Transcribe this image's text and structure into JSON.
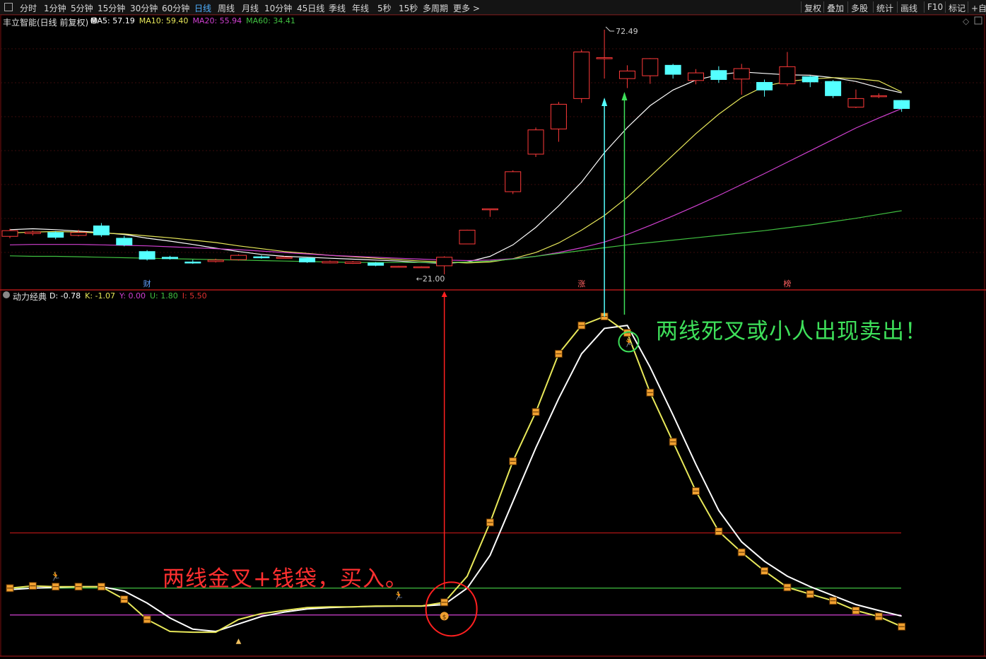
{
  "toolbar": {
    "period_tabs": [
      "分时",
      "1分钟",
      "5分钟",
      "15分钟",
      "30分钟",
      "60分钟",
      "日线",
      "周线",
      "月线",
      "10分钟",
      "45日线",
      "季线",
      "年线",
      "5秒",
      "15秒",
      "多周期",
      "更多 >"
    ],
    "active_tab": "日线",
    "right_tools": [
      "复权",
      "叠加",
      "多股",
      "统计",
      "画线",
      "F10",
      "标记",
      "+自"
    ]
  },
  "main_panel": {
    "stock_title": "丰立智能(日线 前复权)",
    "ma_legend": [
      {
        "label": "MA5: 57.19",
        "color": "#ffffff"
      },
      {
        "label": "MA10: 59.40",
        "color": "#e8e85a"
      },
      {
        "label": "MA20: 55.94",
        "color": "#d040d0"
      },
      {
        "label": "MA60: 34.41",
        "color": "#40c040"
      }
    ],
    "high_label": "72.49",
    "low_label": "21.00",
    "event_tags": [
      "财",
      "涨",
      "榜"
    ]
  },
  "sub_panel": {
    "indicator_name": "动力经典",
    "legend": [
      {
        "label": "D: -0.78",
        "color": "#ffffff"
      },
      {
        "label": "K: -1.07",
        "color": "#e8e85a"
      },
      {
        "label": "Y: 0.00",
        "color": "#d040d0"
      },
      {
        "label": "U: 1.80",
        "color": "#40c040"
      },
      {
        "label": "I: 5.50",
        "color": "#e03030"
      }
    ]
  },
  "annotations": {
    "buy_text": "两线金叉+钱袋，买入。",
    "sell_text": "两线死叉或小人出现卖出！"
  },
  "colors": {
    "up_candle": "#ff3a3a",
    "down_candle": "#54ffff",
    "ma5": "#ffffff",
    "ma10": "#e8e85a",
    "ma20": "#d040d0",
    "ma60": "#40c040",
    "k_line": "#e8e85a",
    "d_line": "#ffffff",
    "buy_text": "#ff3030",
    "sell_text": "#3ee05a",
    "marker": "#f0a030"
  },
  "chart_data": [
    {
      "type": "candlestick",
      "title": "丰立智能(日线 前复权)",
      "ylim": [
        21.0,
        72.49
      ],
      "candles": [
        {
          "o": 29.0,
          "c": 30.2,
          "h": 30.6,
          "l": 28.6
        },
        {
          "o": 29.6,
          "c": 29.9,
          "h": 30.2,
          "l": 29.2
        },
        {
          "o": 29.8,
          "c": 28.8,
          "h": 30.1,
          "l": 28.4
        },
        {
          "o": 29.2,
          "c": 29.8,
          "h": 30.4,
          "l": 29.0
        },
        {
          "o": 31.2,
          "c": 29.3,
          "h": 31.8,
          "l": 28.9
        },
        {
          "o": 28.6,
          "c": 27.2,
          "h": 29.1,
          "l": 26.9
        },
        {
          "o": 25.8,
          "c": 24.2,
          "h": 26.1,
          "l": 23.9
        },
        {
          "o": 24.6,
          "c": 24.3,
          "h": 24.9,
          "l": 24.1
        },
        {
          "o": 23.6,
          "c": 23.5,
          "h": 24.1,
          "l": 23.2
        },
        {
          "o": 23.7,
          "c": 24.0,
          "h": 24.3,
          "l": 23.5
        },
        {
          "o": 24.1,
          "c": 25.0,
          "h": 25.2,
          "l": 23.9
        },
        {
          "o": 24.7,
          "c": 24.5,
          "h": 25.0,
          "l": 24.3
        },
        {
          "o": 24.6,
          "c": 24.6,
          "h": 24.8,
          "l": 24.4
        },
        {
          "o": 24.4,
          "c": 23.6,
          "h": 24.6,
          "l": 23.4
        },
        {
          "o": 23.4,
          "c": 23.7,
          "h": 23.9,
          "l": 23.3
        },
        {
          "o": 23.3,
          "c": 23.6,
          "h": 23.8,
          "l": 23.2
        },
        {
          "o": 23.4,
          "c": 22.9,
          "h": 23.6,
          "l": 22.7
        },
        {
          "o": 22.7,
          "c": 22.7,
          "h": 22.8,
          "l": 22.6
        },
        {
          "o": 22.6,
          "c": 22.6,
          "h": 22.7,
          "l": 22.5
        },
        {
          "o": 22.8,
          "c": 24.6,
          "h": 24.8,
          "l": 21.0
        },
        {
          "o": 27.4,
          "c": 30.3,
          "h": 30.4,
          "l": 27.4
        },
        {
          "o": 34.8,
          "c": 34.8,
          "h": 34.8,
          "l": 33.1
        },
        {
          "o": 38.4,
          "c": 42.6,
          "h": 42.9,
          "l": 37.9
        },
        {
          "o": 46.3,
          "c": 51.4,
          "h": 51.9,
          "l": 45.7
        },
        {
          "o": 51.6,
          "c": 56.8,
          "h": 57.3,
          "l": 48.9
        },
        {
          "o": 58.0,
          "c": 67.8,
          "h": 68.3,
          "l": 57.1
        },
        {
          "o": 66.6,
          "c": 66.6,
          "h": 72.49,
          "l": 62.2
        },
        {
          "o": 62.2,
          "c": 63.8,
          "h": 65.0,
          "l": 60.2
        },
        {
          "o": 62.8,
          "c": 66.4,
          "h": 66.5,
          "l": 61.1
        },
        {
          "o": 65.0,
          "c": 63.1,
          "h": 65.3,
          "l": 62.2
        },
        {
          "o": 61.8,
          "c": 63.4,
          "h": 64.2,
          "l": 61.0
        },
        {
          "o": 63.9,
          "c": 62.0,
          "h": 64.8,
          "l": 61.3
        },
        {
          "o": 62.1,
          "c": 64.3,
          "h": 65.3,
          "l": 58.8
        },
        {
          "o": 61.4,
          "c": 59.8,
          "h": 62.0,
          "l": 58.4
        },
        {
          "o": 61.1,
          "c": 64.7,
          "h": 67.8,
          "l": 60.6
        },
        {
          "o": 62.6,
          "c": 61.5,
          "h": 62.8,
          "l": 60.4
        },
        {
          "o": 61.6,
          "c": 58.6,
          "h": 61.9,
          "l": 58.1
        },
        {
          "o": 56.2,
          "c": 58.0,
          "h": 59.9,
          "l": 56.0
        },
        {
          "o": 58.6,
          "c": 58.6,
          "h": 59.1,
          "l": 58.1
        },
        {
          "o": 57.6,
          "c": 55.9,
          "h": 57.7,
          "l": 55.2
        }
      ],
      "series": [
        {
          "name": "MA5",
          "values": [
            30.4,
            30.6,
            30.4,
            30.1,
            29.8,
            29.4,
            28.6,
            28.0,
            27.3,
            26.5,
            25.8,
            25.2,
            24.8,
            24.6,
            24.4,
            24.2,
            24.0,
            23.8,
            23.5,
            23.3,
            23.6,
            24.8,
            27.2,
            30.9,
            35.4,
            40.4,
            46.6,
            51.9,
            56.5,
            59.8,
            61.9,
            63.0,
            63.6,
            63.3,
            63.0,
            62.9,
            62.4,
            61.6,
            60.3,
            59.2
          ]
        },
        {
          "name": "MA10",
          "values": [
            29.7,
            29.9,
            30.0,
            29.9,
            29.7,
            29.5,
            29.1,
            28.7,
            28.2,
            27.7,
            27.0,
            26.4,
            25.8,
            25.4,
            25.0,
            24.7,
            24.4,
            24.1,
            23.8,
            23.6,
            23.4,
            23.6,
            24.3,
            25.6,
            27.6,
            30.3,
            33.4,
            37.2,
            41.6,
            46.1,
            50.6,
            54.7,
            58.2,
            60.6,
            61.6,
            62.1,
            62.4,
            62.2,
            61.7,
            59.4
          ]
        },
        {
          "name": "MA20",
          "values": [
            27.2,
            27.3,
            27.3,
            27.3,
            27.2,
            27.1,
            27.0,
            26.8,
            26.6,
            26.4,
            26.2,
            25.9,
            25.6,
            25.3,
            25.0,
            24.8,
            24.6,
            24.4,
            24.2,
            24.0,
            23.9,
            24.0,
            24.3,
            24.8,
            25.6,
            26.6,
            27.8,
            29.4,
            31.3,
            33.3,
            35.4,
            37.6,
            39.9,
            42.2,
            44.6,
            47.0,
            49.4,
            51.8,
            53.9,
            55.9
          ]
        },
        {
          "name": "MA60",
          "values": [
            24.9,
            24.8,
            24.8,
            24.7,
            24.6,
            24.5,
            24.4,
            24.3,
            24.2,
            24.1,
            24.0,
            23.9,
            23.8,
            23.7,
            23.6,
            23.5,
            23.5,
            23.5,
            23.5,
            23.5,
            23.6,
            23.8,
            24.2,
            24.8,
            25.4,
            26.0,
            26.6,
            27.2,
            27.7,
            28.2,
            28.7,
            29.2,
            29.7,
            30.2,
            30.8,
            31.4,
            32.1,
            32.8,
            33.6,
            34.4
          ]
        }
      ]
    },
    {
      "type": "line",
      "title": "动力经典",
      "ylim": [
        -2,
        20.5
      ],
      "series": [
        {
          "name": "K",
          "values": [
            1.8,
            1.95,
            1.9,
            1.9,
            1.9,
            1.05,
            -0.3,
            -1.1,
            -1.15,
            -1.15,
            -0.3,
            0.1,
            0.3,
            0.5,
            0.55,
            0.55,
            0.6,
            0.6,
            0.6,
            0.85,
            2.6,
            6.2,
            10.3,
            13.6,
            17.5,
            19.4,
            20.0,
            18.9,
            14.9,
            11.6,
            8.3,
            5.6,
            4.2,
            2.95,
            1.85,
            1.4,
            0.95,
            0.3,
            -0.1,
            -0.78
          ]
        },
        {
          "name": "D",
          "values": [
            1.7,
            1.8,
            1.85,
            1.9,
            1.9,
            1.6,
            0.8,
            -0.2,
            -0.95,
            -1.1,
            -0.6,
            -0.1,
            0.2,
            0.4,
            0.5,
            0.55,
            0.58,
            0.6,
            0.6,
            0.7,
            1.8,
            4.0,
            7.6,
            11.2,
            14.5,
            17.5,
            19.2,
            19.4,
            16.6,
            13.4,
            10.1,
            7.0,
            4.9,
            3.6,
            2.6,
            1.9,
            1.3,
            0.7,
            0.3,
            -0.07
          ]
        }
      ],
      "horizontal_lines": [
        {
          "name": "Y",
          "value": 0.0
        },
        {
          "name": "U",
          "value": 1.8
        },
        {
          "name": "I",
          "value": 5.5
        }
      ]
    }
  ]
}
